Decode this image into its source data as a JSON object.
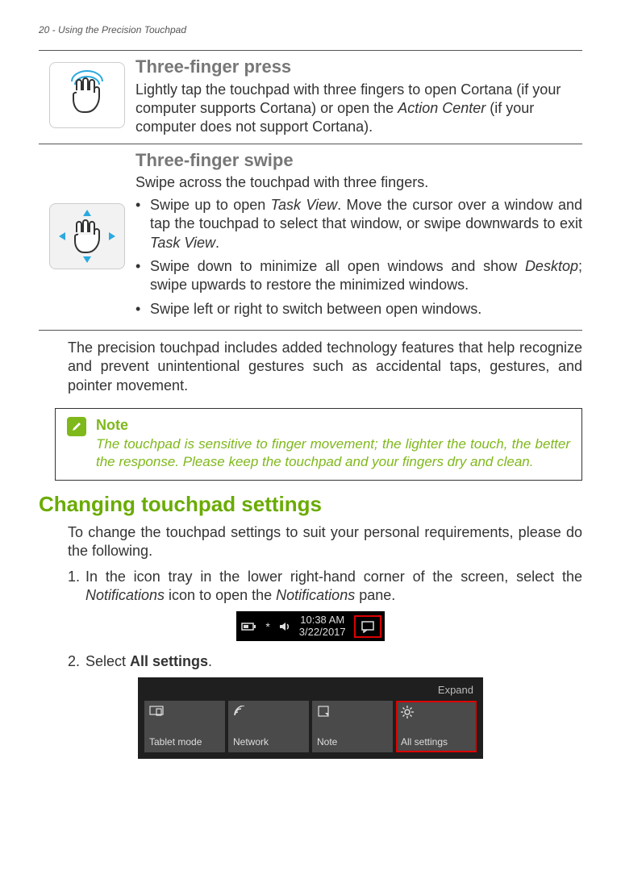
{
  "page_header": "20 - Using the Precision Touchpad",
  "gestures": {
    "press": {
      "title": "Three-finger press",
      "body": "Lightly tap the touchpad with three fingers to open Cortana (if your computer supports Cortana) or open the Action Center (if your computer does not support Cortana)."
    },
    "swipe": {
      "title": "Three-finger swipe",
      "intro": "Swipe across the touchpad with three fingers.",
      "items": [
        "Swipe up to open Task View. Move the cursor over a window and tap the touchpad to select that window, or swipe downwards to exit Task View.",
        "Swipe down to minimize all open windows and show Desktop; swipe upwards to restore the minimized windows.",
        "Swipe left or right to switch between open windows."
      ]
    }
  },
  "body_para": "The precision touchpad includes added technology features that help recognize and prevent unintentional gestures such as accidental taps, gestures, and pointer movement.",
  "note": {
    "title": "Note",
    "body": "The touchpad is sensitive to finger movement; the lighter the touch, the better the response. Please keep the touchpad and your fingers dry and clean."
  },
  "section_heading": "Changing touchpad settings",
  "section_intro": "To change the touchpad settings to suit your personal requirements, please do the following.",
  "steps": {
    "s1_num": "1.",
    "s1_text": "In the icon tray in the lower right-hand corner of the screen, select the Notifications icon to open the Notifications pane.",
    "s2_num": "2.",
    "s2_text_prefix": "Select ",
    "s2_text_bold": "All settings",
    "s2_text_suffix": "."
  },
  "systray": {
    "time": "10:38 AM",
    "date": "3/22/2017"
  },
  "action_center": {
    "expand": "Expand",
    "tiles": [
      {
        "label": "Tablet mode"
      },
      {
        "label": "Network"
      },
      {
        "label": "Note"
      },
      {
        "label": "All settings"
      }
    ]
  }
}
